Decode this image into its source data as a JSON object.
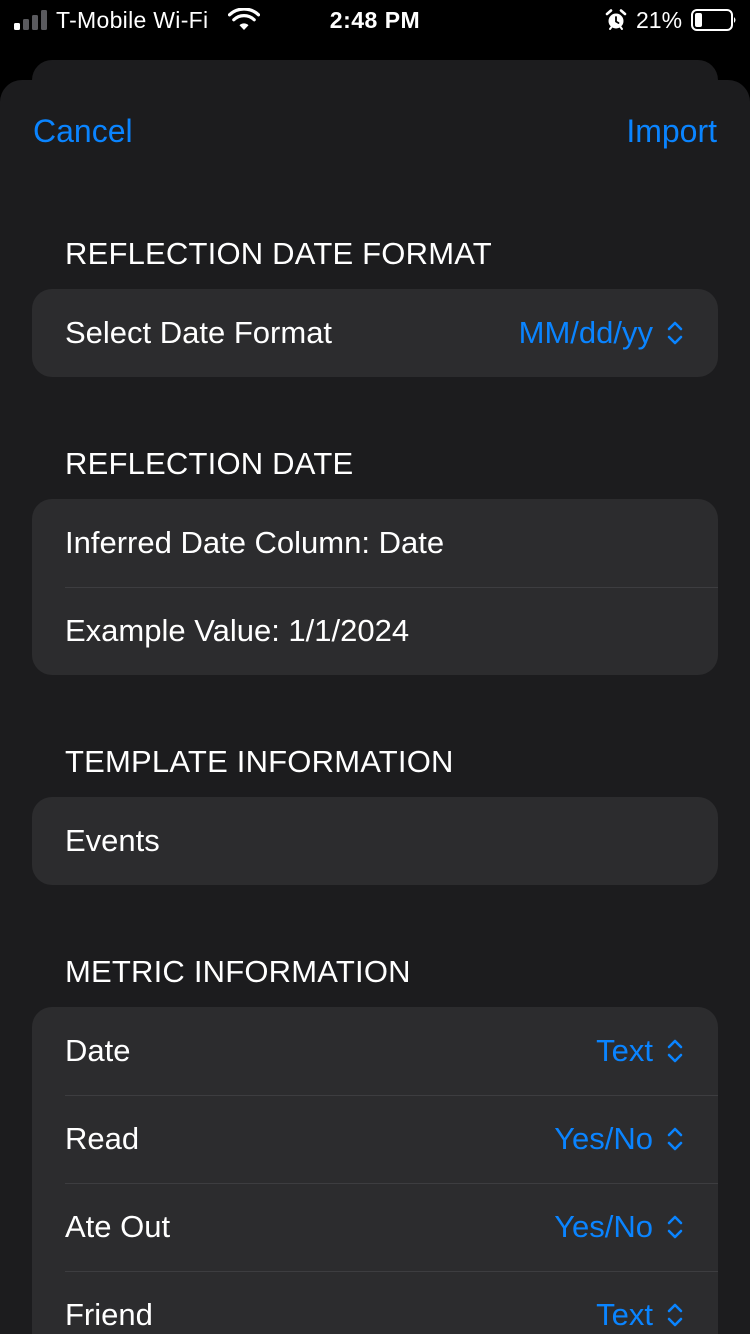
{
  "status_bar": {
    "carrier": "T-Mobile Wi-Fi",
    "time": "2:48 PM",
    "battery_percent": "21%",
    "signal_bars_active": 1,
    "signal_bars_total": 4,
    "battery_level": 0.21,
    "icons": [
      "signal-icon",
      "wifi-icon",
      "alarm-icon",
      "battery-icon"
    ]
  },
  "nav": {
    "cancel_label": "Cancel",
    "import_label": "Import"
  },
  "sections": {
    "date_format": {
      "header": "REFLECTION DATE FORMAT",
      "row_label": "Select Date Format",
      "row_value": "MM/dd/yy"
    },
    "reflection_date": {
      "header": "REFLECTION DATE",
      "rows": [
        {
          "label": "Inferred Date Column: Date"
        },
        {
          "label": "Example Value: 1/1/2024"
        }
      ]
    },
    "template": {
      "header": "TEMPLATE INFORMATION",
      "rows": [
        {
          "label": "Events"
        }
      ]
    },
    "metric": {
      "header": "METRIC INFORMATION",
      "rows": [
        {
          "label": "Date",
          "value": "Text"
        },
        {
          "label": "Read",
          "value": "Yes/No"
        },
        {
          "label": "Ate Out",
          "value": "Yes/No"
        },
        {
          "label": "Friend",
          "value": "Text"
        }
      ]
    }
  },
  "colors": {
    "accent": "#0a84ff",
    "background": "#1c1c1e",
    "cell": "#2c2c2e",
    "text": "#ffffff"
  }
}
